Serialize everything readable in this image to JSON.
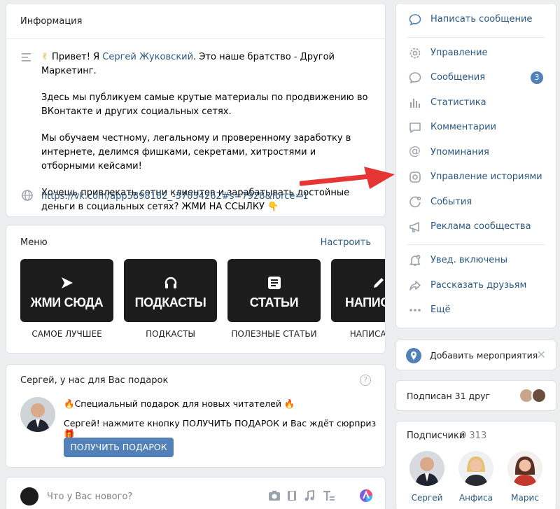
{
  "info": {
    "title": "Информация",
    "greeting_before": "Привет! Я ",
    "greeting_name": "Сергей Жуковский",
    "greeting_after": ". Это наше братство - Другой Маркетинг.",
    "p2": "Здесь мы публикуем самые крутые материалы по продвижению во ВКонтакте и других социальных сетях.",
    "p3": "Мы обучаем честному, легальному и проверенному заработку в интернете, делимся фишками, секретами, хитростями и отборными кейсами!",
    "p4": "Хочешь привлекать сотни клиентов и зарабатывать достойные деньги в социальных сетях? ЖМИ НА ССЫЛКУ 👇",
    "url": "https://vk.com/app5898182_-37034262#s=7928&force=1"
  },
  "menu": {
    "title": "Меню",
    "configure": "Настроить",
    "tiles": [
      {
        "text": "ЖМИ СЮДА",
        "label": "САМОЕ ЛУЧШЕЕ",
        "icon": "send-arrow-icon"
      },
      {
        "text": "ПОДКАСТЫ",
        "label": "ПОДКАСТЫ",
        "icon": "headphones-icon"
      },
      {
        "text": "СТАТЬИ",
        "label": "ПОЛЕЗНЫЕ СТАТЬИ",
        "icon": "article-icon"
      },
      {
        "text": "НАПИС",
        "label": "НАПИСАТЬ В",
        "icon": "pencil-icon"
      }
    ]
  },
  "gift": {
    "title": "Сергей, у нас для Вас подарок",
    "help": "?",
    "line1": "🔥Специальный подарок для новых читателей 🔥",
    "line2": "Сергей! нажмите кнопку ПОЛУЧИТЬ ПОДАРОК и Вас ждёт сюрприз 🎁",
    "button": "ПОЛУЧИТЬ ПОДАРОК"
  },
  "composer": {
    "placeholder": "Что у Вас нового?"
  },
  "actions": {
    "write": "Написать сообщение",
    "items": [
      {
        "label": "Управление",
        "icon": "gear-icon"
      },
      {
        "label": "Сообщения",
        "icon": "message-bubble-icon",
        "badge": "3"
      },
      {
        "label": "Статистика",
        "icon": "bar-chart-icon"
      },
      {
        "label": "Комментарии",
        "icon": "comment-icon"
      },
      {
        "label": "Упоминания",
        "icon": "at-sign-icon"
      },
      {
        "label": "Управление историями",
        "icon": "stories-icon"
      },
      {
        "label": "События",
        "icon": "events-icon"
      },
      {
        "label": "Реклама сообщества",
        "icon": "megaphone-icon"
      }
    ],
    "items2": [
      {
        "label": "Увед. включены",
        "icon": "bell-icon"
      },
      {
        "label": "Рассказать друзьям",
        "icon": "share-icon"
      },
      {
        "label": "Ещё",
        "icon": "more-dots-icon"
      }
    ]
  },
  "add_event": {
    "label": "Добавить мероприятия",
    "close": "✕"
  },
  "friends": {
    "label": "Подписан 31 друг"
  },
  "followers": {
    "title": "Подписчики",
    "count": "9 313",
    "people": [
      {
        "name": "Сергей"
      },
      {
        "name": "Анфиса"
      },
      {
        "name": "Марис"
      }
    ]
  },
  "colors": {
    "accent": "#5181b8",
    "link": "#2a5885",
    "arrow": "#e63535"
  }
}
